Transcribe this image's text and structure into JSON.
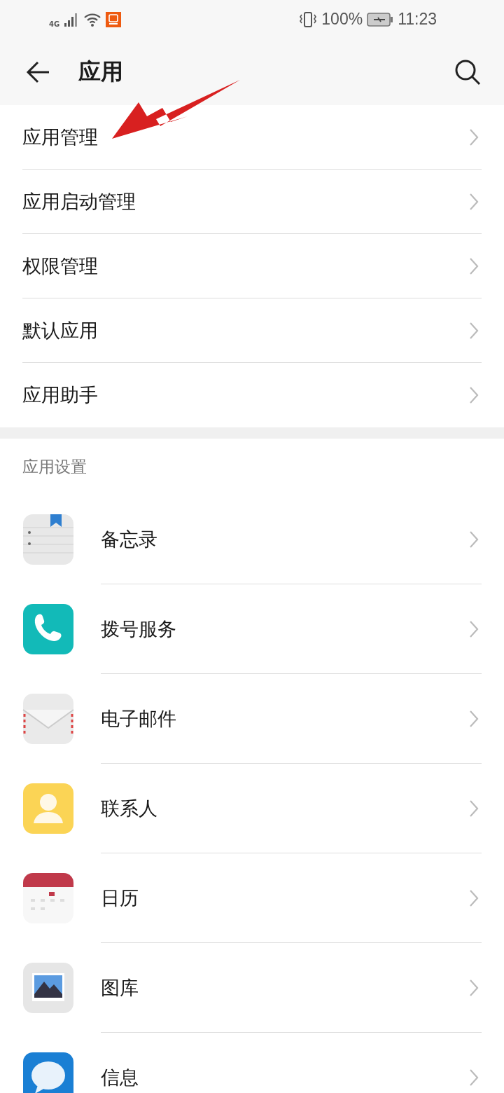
{
  "status_bar": {
    "network": "4G",
    "battery": "100%",
    "time": "11:23"
  },
  "header": {
    "title": "应用"
  },
  "menu": [
    {
      "label": "应用管理"
    },
    {
      "label": "应用启动管理"
    },
    {
      "label": "权限管理"
    },
    {
      "label": "默认应用"
    },
    {
      "label": "应用助手"
    }
  ],
  "section": {
    "title": "应用设置"
  },
  "apps": [
    {
      "label": "备忘录",
      "kind": "notes"
    },
    {
      "label": "拨号服务",
      "kind": "phone"
    },
    {
      "label": "电子邮件",
      "kind": "mail"
    },
    {
      "label": "联系人",
      "kind": "contacts"
    },
    {
      "label": "日历",
      "kind": "calendar"
    },
    {
      "label": "图库",
      "kind": "gallery"
    },
    {
      "label": "信息",
      "kind": "messages"
    }
  ]
}
